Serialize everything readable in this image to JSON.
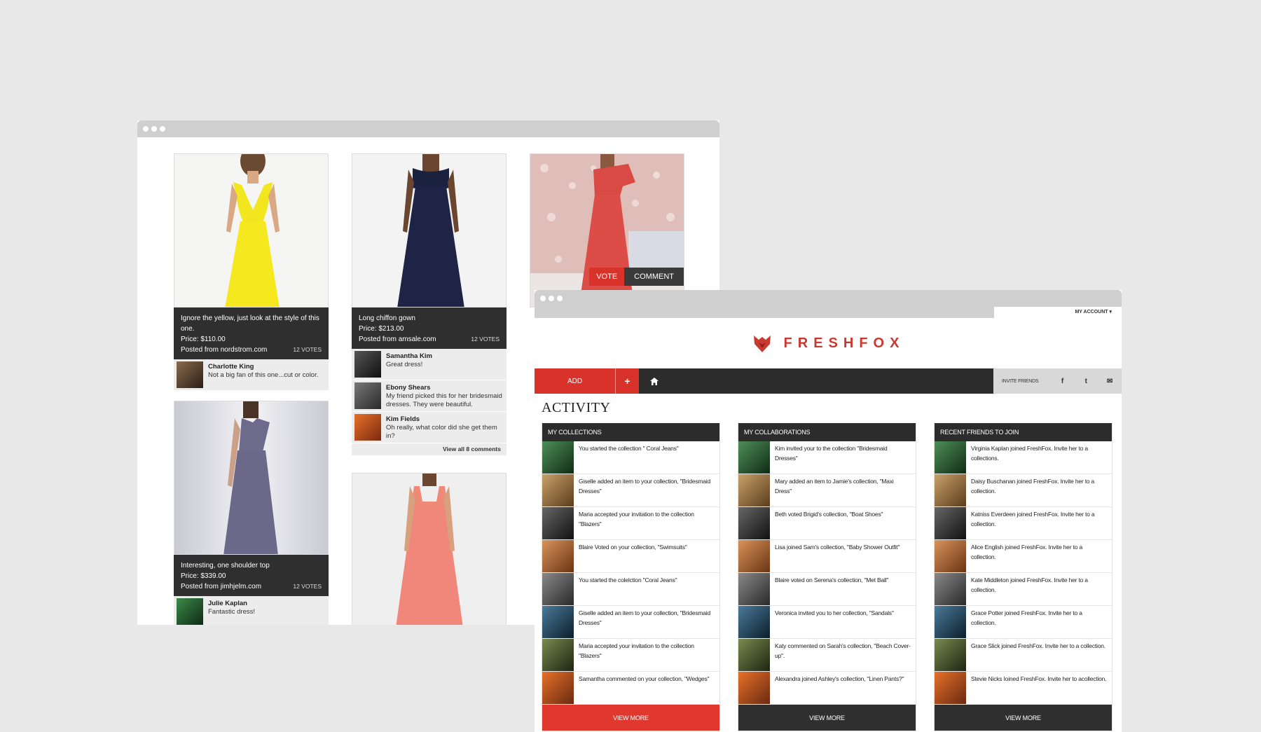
{
  "grid": {
    "cards": [
      {
        "caption": "Ignore the yellow, just look at the style of this one.",
        "price": "Price: $110.00",
        "source": "Posted from nordstrom.com",
        "votes": "12 VOTES",
        "comments": [
          {
            "name": "Charlotte King",
            "text": "Not a big fan of this one...cut or color."
          }
        ]
      },
      {
        "caption": "Long chiffon gown",
        "price": "Price: $213.00",
        "source": "Posted from amsale.com",
        "votes": "12 VOTES",
        "comments": [
          {
            "name": "Samantha Kim",
            "text": "Great dress!"
          },
          {
            "name": "Ebony Shears",
            "text": "My friend picked this for her bridesmaid dresses. They were beautiful."
          },
          {
            "name": "Kim Fields",
            "text": "Oh really, what color did she get them in?"
          }
        ],
        "view_all": "View all 8 comments"
      },
      {
        "vote_label": "VOTE",
        "comment_label": "COMMENT"
      },
      {
        "caption": "Interesting, one shoulder top",
        "price": "Price: $339.00",
        "source": "Posted from jimhjelm.com",
        "votes": "12 VOTES",
        "comments": [
          {
            "name": "Julie Kaplan",
            "text": "Fantastic dress!"
          }
        ]
      }
    ]
  },
  "app": {
    "account": "MY ACCOUNT",
    "brand": "FRESHFOX",
    "nav": {
      "add": "ADD",
      "plus": "+",
      "invite": "INVITE FRIENDS",
      "facebook": "f",
      "twitter": "t",
      "email": "✉"
    },
    "title": "ACTIVITY",
    "columns": [
      {
        "title": "MY COLLECTIONS",
        "view_more": "VIEW MORE",
        "items": [
          "You started the collection \" Coral Jeans\"",
          "Giselle added an item to your collection, \"Bridesmaid Dresses\"",
          "Maria accepted your invitation to the collection \"Blazers\"",
          "Blaire Voted on your collection, \"Swimsuits\"",
          "You started the colelction \"Coral Jeans\"",
          "Giselle added an item to your collection, \"Bridesmaid Dresses\"",
          "Maria accepted your invitation to the collection \"Blazers\"",
          "Samantha commented on your collection, \"Wedges\""
        ]
      },
      {
        "title": "MY COLLABORATIONS",
        "view_more": "VIEW MORE",
        "items": [
          "Kim invited your to the collection \"Bridesmaid Dresses\"",
          "Mary added an item to Jamie's collection, \"Maxi Dress\"",
          "Beth voted Brigid's collection, \"Boat Shoes\"",
          "Lisa joined Sam's collection, \"Baby Shower Outfit\"",
          "Blaire voted on Serena's collection, \"Met Ball\"",
          "Veronica invited you to her collection, \"Sandals\"",
          "Katy commented on Sarah's collection, \"Beach Cover-up\".",
          "Alexandra joined Ashley's collection, \"Linen Pants?\""
        ]
      },
      {
        "title": "RECENT FRIENDS TO JOIN",
        "view_more": "VIEW MORE",
        "items": [
          "Virginia Kaplan joined FreshFox. Invite her to a collections.",
          "Daisy Buschanan joined FreshFox. Invite her to a collection.",
          "Katniss Everdeen joined FreshFox. Invite her to a collection.",
          "Alice English joined FreshFox. Invite her to a collection.",
          "Kate Middleton joined FreshFox. Invite her to a collection.",
          "Grace Potter joined FreshFox. Invite her to a collection.",
          "Grace Slick joined FreshFox. Invite her to a collection.",
          "Stevie Nicks Ioined FreshFox. Invite her to acollection."
        ]
      }
    ]
  },
  "colors": {
    "accent": "#d8322a",
    "dark": "#2c2c2c",
    "background": "#e8e8e8"
  }
}
